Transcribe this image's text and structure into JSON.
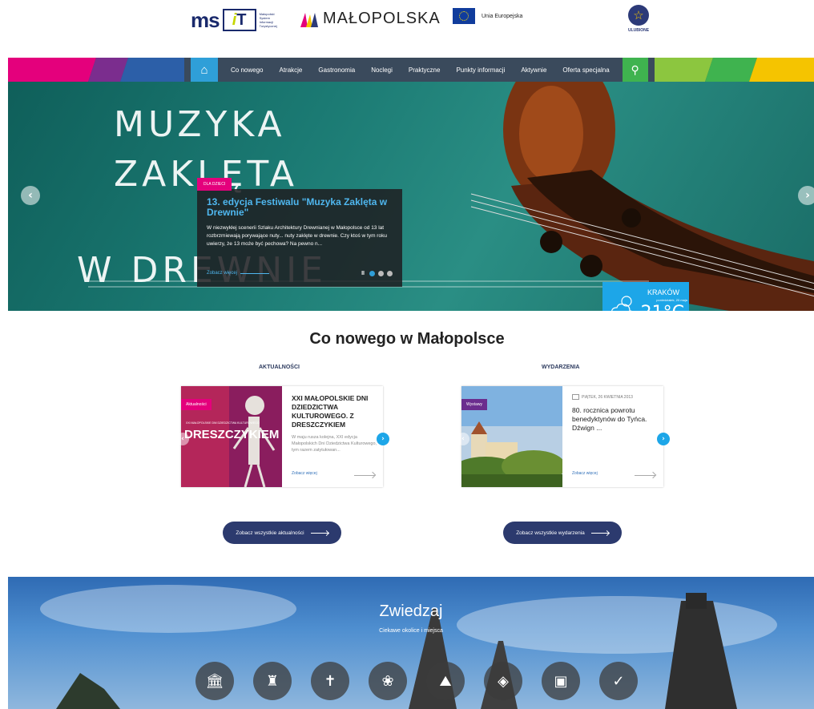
{
  "header": {
    "msit_logo": "ms IT",
    "msit_small": "Małopolski System Informacji Turystycznej",
    "malopolska": "MAŁOPOLSKA",
    "eu": "Unia Europejska",
    "favorites": "ULUBIONE"
  },
  "nav": {
    "items": [
      "Co nowego",
      "Atrakcje",
      "Gastronomia",
      "Noclegi",
      "Praktyczne",
      "Punkty informacji",
      "Aktywnie",
      "Oferta specjalna"
    ]
  },
  "hero": {
    "line1": "MUZYKA",
    "line2": "ZAKLĘTA",
    "line3": "W DREWNIE",
    "tag": "DLA DZIECI",
    "title": "13. edycja Festiwalu \"Muzyka Zaklęta w Drewnie\"",
    "desc": "W niezwykłej scenerii Szlaku Architektury Drewnianej w Małopolsce od 13 lat rozbrzmiewają porywające nuty... nuty zaklęte w drewnie. Czy ktoś w tym roku uwierzy, że 13 może być pechowa? Na pewno n...",
    "more": "Zobacz więcej",
    "pause": "II",
    "slides": 3,
    "active_slide": 1
  },
  "weather": {
    "city": "KRAKÓW",
    "date": "poniedziałek, 20 maja",
    "temp": "21°C"
  },
  "news": {
    "title": "Co nowego w Małopolsce",
    "aktualnosci": {
      "label": "AKTUALNOŚCI",
      "badge": "Aktualności",
      "poster_small": "XXI MAŁOPOLSKIE DNI DZIEDZICTWA KULTUROWEGO",
      "poster_big": "DRESZCZYKIEM",
      "title": "XXI MAŁOPOLSKIE DNI DZIEDZICTWA KULTUROWEGO. Z DRESZCZYKIEM",
      "desc": "W maju rusza kolejna, XXI edycja Małopolskich Dni Dziedzictwa Kulturowego, tym razem zatytułowan...",
      "more": "Zobacz więcej",
      "all": "Zobacz wszystkie aktualności"
    },
    "wydarzenia": {
      "label": "WYDARZENIA",
      "badge": "Wystawy",
      "date": "PIĄTEK, 26 KWIETNIA 2013",
      "title": "80. rocznica powrotu benedyktynów do Tyńca. Dźwign ...",
      "more": "Zobacz więcej",
      "all": "Zobacz wszystkie wydarzenia"
    }
  },
  "explore": {
    "title": "Zwiedzaj",
    "subtitle": "Ciekawe okolice i miejsca"
  },
  "icons": {
    "home": "home-icon",
    "search": "search-icon",
    "star": "star-icon",
    "weather": "partly-cloudy-icon"
  }
}
